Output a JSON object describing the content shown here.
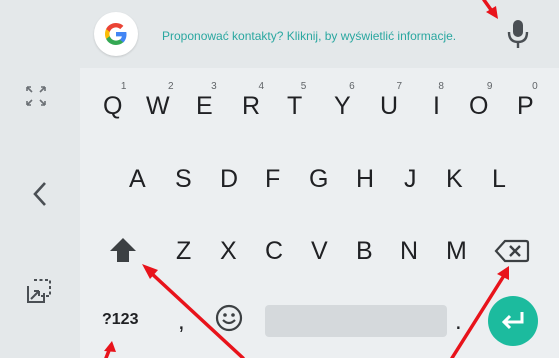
{
  "suggestion_strip": {
    "text": "Proponować kontakty? Kliknij, by wyświetlić informacje."
  },
  "keyboard": {
    "row1": [
      {
        "letter": "Q",
        "hint": "1"
      },
      {
        "letter": "W",
        "hint": "2"
      },
      {
        "letter": "E",
        "hint": "3"
      },
      {
        "letter": "R",
        "hint": "4"
      },
      {
        "letter": "T",
        "hint": "5"
      },
      {
        "letter": "Y",
        "hint": "6"
      },
      {
        "letter": "U",
        "hint": "7"
      },
      {
        "letter": "I",
        "hint": "8"
      },
      {
        "letter": "O",
        "hint": "9"
      },
      {
        "letter": "P",
        "hint": "0"
      }
    ],
    "row2": [
      "A",
      "S",
      "D",
      "F",
      "G",
      "H",
      "J",
      "K",
      "L"
    ],
    "row3": [
      "Z",
      "X",
      "C",
      "V",
      "B",
      "N",
      "M"
    ],
    "bottom": {
      "symbols_label": "?123",
      "comma_label": ",",
      "period_label": "."
    }
  },
  "colors": {
    "accent": "#1cbb9e",
    "suggestion_text": "#2aa7a0",
    "annotation_arrow": "#e8131b"
  },
  "icons": {
    "google_logo": "google-g-logo",
    "mic": "microphone-icon",
    "resize": "expand-arrows-icon",
    "back": "chevron-left-icon",
    "float": "floating-keyboard-icon",
    "shift": "shift-arrow-icon",
    "backspace": "backspace-icon",
    "emoji": "smiley-icon",
    "enter": "enter-arrow-icon"
  }
}
